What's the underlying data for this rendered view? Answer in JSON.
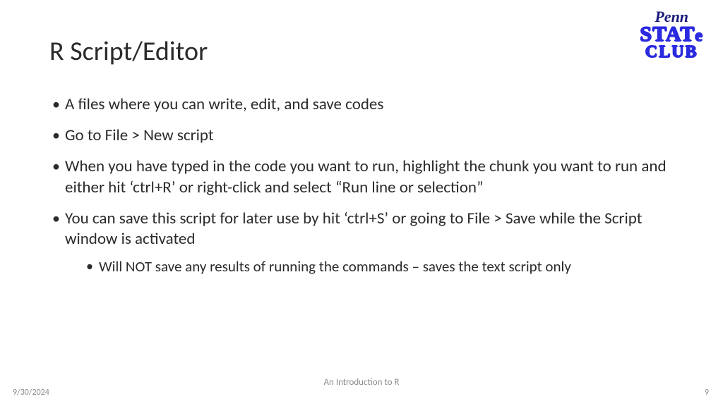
{
  "title": "R Script/Editor",
  "logo": {
    "line1": "Penn",
    "line2a": "STAT",
    "line2b": "e",
    "line3": "CLUB"
  },
  "bullets": [
    {
      "text": "A files where you can write, edit, and save codes"
    },
    {
      "text": "Go to File > New script"
    },
    {
      "text": "When you have typed in the code you want to run, highlight the chunk you want to run and either hit ‘ctrl+R’ or right-click and select “Run line or selection”"
    },
    {
      "text": "You can save this script for later use by hit ‘ctrl+S’ or going to File > Save while the Script window is activated",
      "sub": [
        {
          "text": "Will NOT save any results of running the commands – saves the text script only"
        }
      ]
    }
  ],
  "footer": {
    "date": "9/30/2024",
    "title": "An Introduction to R",
    "page": "9"
  }
}
